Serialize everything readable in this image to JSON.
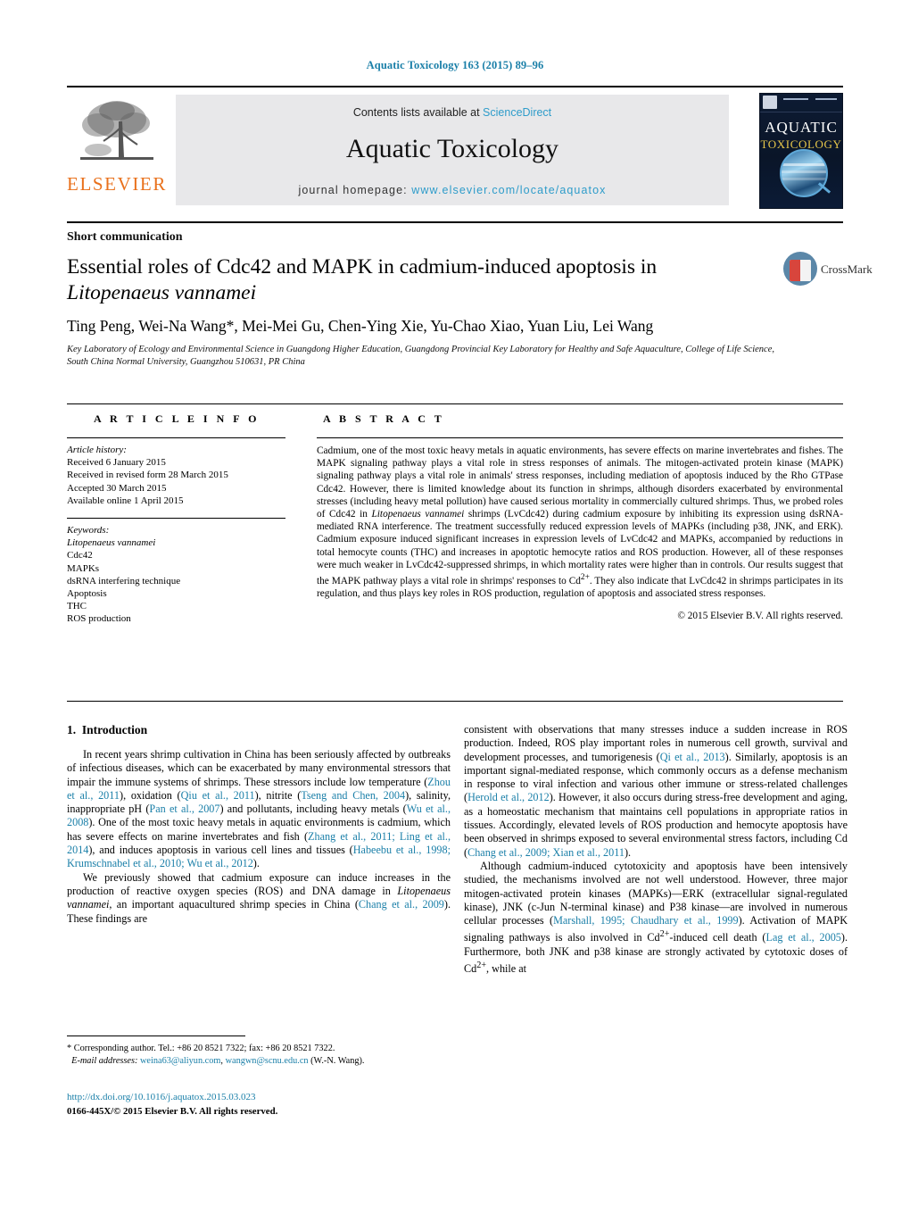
{
  "running_head": "Aquatic Toxicology 163 (2015) 89–96",
  "journal_header": {
    "contents_prefix": "Contents lists available at ",
    "contents_link": "ScienceDirect",
    "journal_title": "Aquatic Toxicology",
    "homepage_label": "journal homepage: ",
    "homepage_url": "www.elsevier.com/locate/aquatox",
    "publisher_logo_text": "ELSEVIER",
    "cover_line1": "AQUATIC",
    "cover_line2": "TOXICOLOGY"
  },
  "article": {
    "type": "Short communication",
    "title_line1": "Essential roles of Cdc42 and MAPK in cadmium-induced apoptosis in",
    "title_line2": "Litopenaeus vannamei",
    "crossmark_label": "CrossMark",
    "authors": "Ting Peng, Wei-Na Wang*, Mei-Mei Gu, Chen-Ying Xie, Yu-Chao Xiao, Yuan Liu, Lei Wang",
    "affiliation": "Key Laboratory of Ecology and Environmental Science in Guangdong Higher Education, Guangdong Provincial Key Laboratory for Healthy and Safe Aquaculture, College of Life Science, South China Normal University, Guangzhou 510631, PR China"
  },
  "article_info": {
    "heading": "A R T I C L E   I N F O",
    "history_label": "Article history:",
    "history": [
      "Received 6 January 2015",
      "Received in revised form 28 March 2015",
      "Accepted 30 March 2015",
      "Available online 1 April 2015"
    ],
    "keywords_label": "Keywords:",
    "keywords": [
      "Litopenaeus vannamei",
      "Cdc42",
      "MAPKs",
      "dsRNA interfering technique",
      "Apoptosis",
      "THC",
      "ROS production"
    ]
  },
  "abstract": {
    "heading": "A B S T R A C T",
    "text_p1": "Cadmium, one of the most toxic heavy metals in aquatic environments, has severe effects on marine invertebrates and fishes. The MAPK signaling pathway plays a vital role in stress responses of animals. The mitogen-activated protein kinase (MAPK) signaling pathway plays a vital role in animals' stress responses, including mediation of apoptosis induced by the Rho GTPase Cdc42. However, there is limited knowledge about its function in shrimps, although disorders exacerbated by environmental stresses (including heavy metal pollution) have caused serious mortality in commercially cultured shrimps. Thus, we probed roles of Cdc42 in ",
    "species_italic": "Litopenaeus vannamei",
    "text_p2": " shrimps (LvCdc42) during cadmium exposure by inhibiting its expression using dsRNA-mediated RNA interference. The treatment successfully reduced expression levels of MAPKs (including p38, JNK, and ERK). Cadmium exposure induced significant increases in expression levels of LvCdc42 and MAPKs, accompanied by reductions in total hemocyte counts (THC) and increases in apoptotic hemocyte ratios and ROS production. However, all of these responses were much weaker in LvCdc42-suppressed shrimps, in which mortality rates were higher than in controls. Our results suggest that the MAPK pathway plays a vital role in shrimps' responses to Cd",
    "sup1": "2+",
    "text_p3": ". They also indicate that LvCdc42 in shrimps participates in its regulation, and thus plays key roles in ROS production, regulation of apoptosis and associated stress responses.",
    "copyright": "© 2015 Elsevier B.V. All rights reserved."
  },
  "body": {
    "section_number": "1.",
    "section_title": "Introduction",
    "left_p1_a": "In recent years shrimp cultivation in China has been seriously affected by outbreaks of infectious diseases, which can be exacerbated by many environmental stressors that impair the immune systems of shrimps. These stressors include low temperature (",
    "cite_zhou": "Zhou et al., 2011",
    "left_p1_b": "), oxidation (",
    "cite_qiu": "Qiu et al., 2011",
    "left_p1_c": "), nitrite (",
    "cite_tseng": "Tseng and Chen, 2004",
    "left_p1_d": "), salinity, inappropriate pH (",
    "cite_pan": "Pan et al., 2007",
    "left_p1_e": ") and pollutants, including heavy metals (",
    "cite_wu2008": "Wu et al., 2008",
    "left_p1_f": "). One of the most toxic heavy metals in aquatic environments is cadmium, which has severe effects on marine invertebrates and fish (",
    "cite_zhang_ling": "Zhang et al., 2011; Ling et al., 2014",
    "left_p1_g": "), and induces apoptosis in various cell lines and tissues (",
    "cite_habeebu": "Habeebu et al., 1998; Krumschnabel et al., 2010; Wu et al., 2012",
    "left_p1_h": ").",
    "left_p2_a": "We previously showed that cadmium exposure can induce increases in the production of reactive oxygen species (ROS) and DNA damage in ",
    "left_p2_italic": "Litopenaeus vannamei",
    "left_p2_b": ", an important aquacultured shrimp species in China (",
    "cite_chang2009": "Chang et al., 2009",
    "left_p2_c": "). These findings are",
    "right_p1_a": "consistent with observations that many stresses induce a sudden increase in ROS production. Indeed, ROS play important roles in numerous cell growth, survival and development processes, and tumorigenesis (",
    "cite_qi": "Qi et al., 2013",
    "right_p1_b": "). Similarly, apoptosis is an important signal-mediated response, which commonly occurs as a defense mechanism in response to viral infection and various other immune or stress-related challenges (",
    "cite_herold": "Herold et al., 2012",
    "right_p1_c": "). However, it also occurs during stress-free development and aging, as a homeostatic mechanism that maintains cell populations in appropriate ratios in tissues. Accordingly, elevated levels of ROS production and hemocyte apoptosis have been observed in shrimps exposed to several environmental stress factors, including Cd (",
    "cite_chang_xian": "Chang et al., 2009; Xian et al., 2011",
    "right_p1_d": ").",
    "right_p2_a": "Although cadmium-induced cytotoxicity and apoptosis have been intensively studied, the mechanisms involved are not well understood. However, three major mitogen-activated protein kinases (MAPKs)—ERK (extracellular signal-regulated kinase), JNK (c-Jun N-terminal kinase) and P38 kinase—are involved in numerous cellular processes (",
    "cite_marshall": "Marshall, 1995; Chaudhary et al., 1999",
    "right_p2_b": "). Activation of MAPK signaling pathways is also involved in Cd",
    "sup_cd1": "2+",
    "right_p2_c": "-induced cell death (",
    "cite_lag": "Lag et al., 2005",
    "right_p2_d": "). Furthermore, both JNK and p38 kinase are strongly activated by cytotoxic doses of Cd",
    "sup_cd2": "2+",
    "right_p2_e": ", while at"
  },
  "footnotes": {
    "corresponding": "* Corresponding author. Tel.: +86 20 8521 7322; fax: +86 20 8521 7322.",
    "email_label": "E-mail addresses:",
    "email1": "weina63@aliyun.com",
    "email_sep": ", ",
    "email2": "wangwn@scnu.edu.cn",
    "email_suffix": " (W.-N. Wang).",
    "doi": "http://dx.doi.org/10.1016/j.aquatox.2015.03.023",
    "issn": "0166-445X/© 2015 Elsevier B.V. All rights reserved."
  }
}
